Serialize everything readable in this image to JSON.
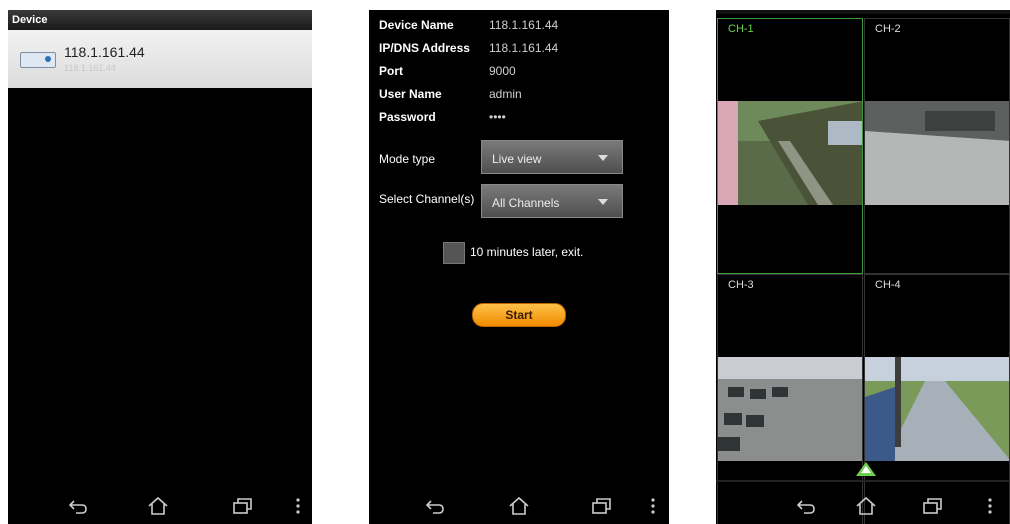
{
  "screen1": {
    "title": "Device",
    "device": {
      "name": "118.1.161.44",
      "subtitle": "118.1.161.44"
    }
  },
  "screen2": {
    "fields": [
      {
        "label": "Device Name",
        "value": "118.1.161.44"
      },
      {
        "label": "IP/DNS Address",
        "value": "118.1.161.44"
      },
      {
        "label": "Port",
        "value": "9000"
      },
      {
        "label": "User Name",
        "value": "admin"
      },
      {
        "label": "Password",
        "value": "••••"
      }
    ],
    "mode_type_label": "Mode type",
    "mode_type_value": "Live view",
    "select_channels_label": "Select Channel(s)",
    "select_channels_value": "All Channels",
    "auto_exit_label": "10 minutes later, exit.",
    "start_label": "Start"
  },
  "screen3": {
    "channels": [
      "CH-1",
      "CH-2",
      "CH-3",
      "CH-4"
    ]
  },
  "colors": {
    "accent_green": "#6fcf4e",
    "start_orange": "#f5a623"
  },
  "icons": [
    "back-icon",
    "home-icon",
    "recent-apps-icon",
    "menu-dots-icon",
    "device-icon",
    "ptz-up-icon"
  ]
}
